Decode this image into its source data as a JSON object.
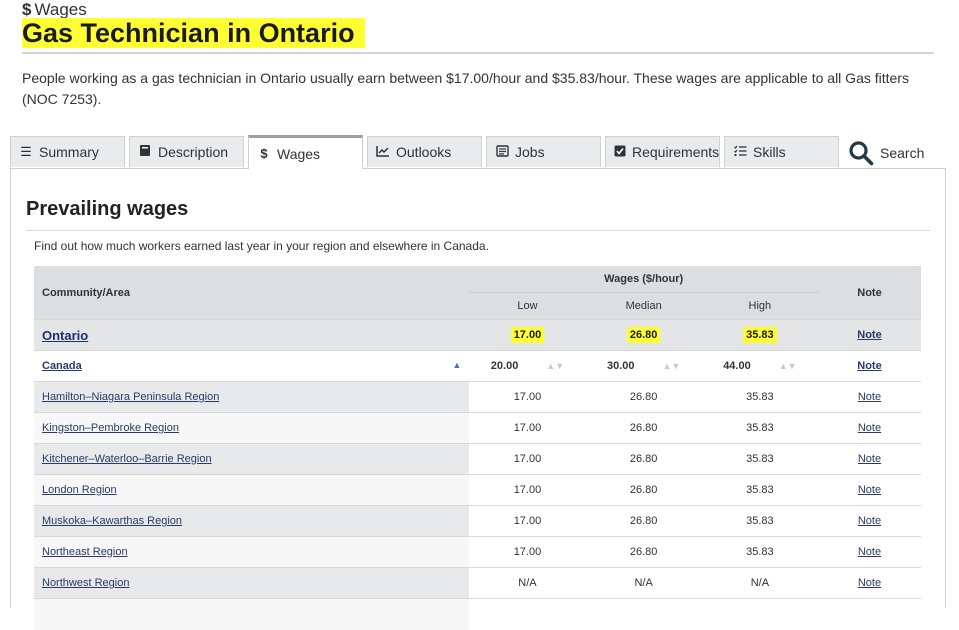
{
  "header": {
    "kicker_icon": "dollar-sign-icon",
    "kicker_label": "Wages",
    "title": "Gas Technician in Ontario",
    "intro": "People working as a gas technician in Ontario usually earn between $17.00/hour and $35.83/hour. These wages are applicable to all Gas fitters (NOC 7253)."
  },
  "tabs": [
    {
      "label": "Summary",
      "icon": "list-icon"
    },
    {
      "label": "Description",
      "icon": "book-icon"
    },
    {
      "label": "Wages",
      "icon": "dollar-icon",
      "active": true
    },
    {
      "label": "Outlooks",
      "icon": "chart-line-icon"
    },
    {
      "label": "Jobs",
      "icon": "newspaper-icon"
    },
    {
      "label": "Requirements",
      "icon": "checkbox-icon"
    },
    {
      "label": "Skills",
      "icon": "checklist-icon"
    }
  ],
  "search": {
    "label": "Search",
    "icon": "magnifier-icon"
  },
  "section": {
    "title": "Prevailing wages",
    "lead": "Find out how much workers earned last year in your region and elsewhere in Canada."
  },
  "table": {
    "col_area": "Community/Area",
    "col_wages": "Wages ($/hour)",
    "col_low": "Low",
    "col_median": "Median",
    "col_high": "High",
    "col_note": "Note",
    "province": {
      "area": "Ontario",
      "low": "17.00",
      "median": "26.80",
      "high": "35.83",
      "note": "Note"
    },
    "canada": {
      "area": "Canada",
      "low": "20.00",
      "median": "30.00",
      "high": "44.00",
      "note": "Note"
    },
    "rows": [
      {
        "area": "Hamilton–Niagara Peninsula Region",
        "low": "17.00",
        "median": "26.80",
        "high": "35.83",
        "note": "Note"
      },
      {
        "area": "Kingston–Pembroke Region",
        "low": "17.00",
        "median": "26.80",
        "high": "35.83",
        "note": "Note"
      },
      {
        "area": "Kitchener–Waterloo–Barrie Region",
        "low": "17.00",
        "median": "26.80",
        "high": "35.83",
        "note": "Note"
      },
      {
        "area": "London Region",
        "low": "17.00",
        "median": "26.80",
        "high": "35.83",
        "note": "Note"
      },
      {
        "area": "Muskoka–Kawarthas Region",
        "low": "17.00",
        "median": "26.80",
        "high": "35.83",
        "note": "Note"
      },
      {
        "area": "Northeast Region",
        "low": "17.00",
        "median": "26.80",
        "high": "35.83",
        "note": "Note"
      },
      {
        "area": "Northwest Region",
        "low": "N/A",
        "median": "N/A",
        "high": "N/A",
        "note": "Note"
      },
      {
        "area": "",
        "low": "",
        "median": "",
        "high": "",
        "note": ""
      }
    ]
  },
  "colors": {
    "highlight": "#ffff33",
    "link": "#2b3a67",
    "header_bg": "#dcdee1"
  }
}
